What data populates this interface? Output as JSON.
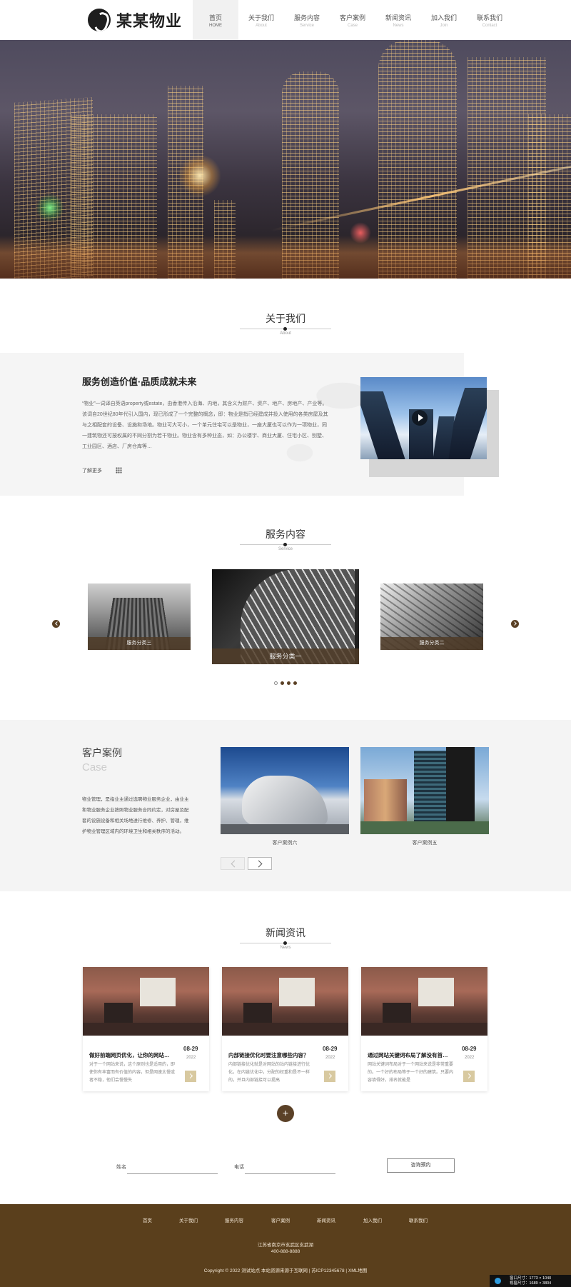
{
  "brand": {
    "name": "某某物业"
  },
  "nav": [
    {
      "cn": "首页",
      "en": "HOME"
    },
    {
      "cn": "关于我们",
      "en": "About"
    },
    {
      "cn": "服务内容",
      "en": "Service"
    },
    {
      "cn": "客户案例",
      "en": "Case"
    },
    {
      "cn": "新闻资讯",
      "en": "News"
    },
    {
      "cn": "加入我们",
      "en": "Join"
    },
    {
      "cn": "联系我们",
      "en": "Contact"
    }
  ],
  "about": {
    "title_cn": "关于我们",
    "title_en": "About",
    "heading": "服务创造价值·品质成就未来",
    "paragraph": "“物业”一词译自英语property或estate，由香港传入沿海、内地，其含义为财产、资产、地产、房地产、产业等。该词自20世纪80年代引入国内，现已形成了一个完整的概念，即：物业是指已经建成并投入使用的各类房屋及其与之相配套的设备、设施和场地。物业可大可小，一个单元住宅可以是物业，一座大厦也可以作为一项物业，同一建筑物还可按权属的不同分割为若干物业。物业含有多种业态，如：办公楼宇、商业大厦、住宅小区、别墅、工业园区、酒店、厂房仓库等…",
    "more": "了解更多"
  },
  "service": {
    "title_cn": "服务内容",
    "title_en": "Service",
    "items": [
      {
        "label": "服务分类三"
      },
      {
        "label": "服务分类一"
      },
      {
        "label": "服务分类二"
      }
    ]
  },
  "cases": {
    "title_cn": "客户案例",
    "title_en": "Case",
    "paragraph": "物业管理，是指业主通过选聘物业服务企业，由业主和物业服务企业按照物业服务合同约定，对房屋及配套的设施设备和相关场地进行维修、养护、管理，维护物业管理区域内的环境卫生和相关秩序的活动。",
    "items": [
      {
        "caption": "客户案例六"
      },
      {
        "caption": "客户案例五"
      }
    ]
  },
  "news": {
    "title_cn": "新闻资讯",
    "title_en": "News",
    "items": [
      {
        "title": "做好前端网页优化，让你的网站…",
        "desc": "对于一个网站来说，这个原则也是适用的，即使你有丰富而有价值的内容，但是网速太慢或者不稳，他们会慢慢失",
        "date": "08-29",
        "year": "2022"
      },
      {
        "title": "内部链接优化时要注意哪些内容？",
        "desc": "内部链接优化就是对网站的站内链接进行优化，在内链优化中，分配的权重和是不一样的，并且内部链接可以提高",
        "date": "08-29",
        "year": "2022"
      },
      {
        "title": "通过网站关键词布局了解没有首…",
        "desc": "网站关键词布局对于一个网站来说是非常重要的。一个好的布局等于一个好的建筑。只要内容填得好，排名就能是",
        "date": "08-29",
        "year": "2022"
      }
    ]
  },
  "form": {
    "name_label": "姓名",
    "phone_label": "电话",
    "submit": "咨询预约"
  },
  "footer": {
    "nav": [
      "首页",
      "关于我们",
      "服务内容",
      "客户案例",
      "新闻资讯",
      "加入我们",
      "联系我们"
    ],
    "address": "江苏省南京市玄武区玄武湖",
    "tel": "400-888-8888",
    "copyright": "Copyright © 2022 测试站点 本站资源来源于互联网 | 苏ICP12345678 | XML地图"
  },
  "size_badge": {
    "line1": "窗口尺寸：1773 × 1040",
    "line2": "视窗尺寸：1689 × 3804"
  },
  "colors": {
    "brand_brown": "#5a3f1c",
    "accent_gold": "#d8c9a0"
  }
}
